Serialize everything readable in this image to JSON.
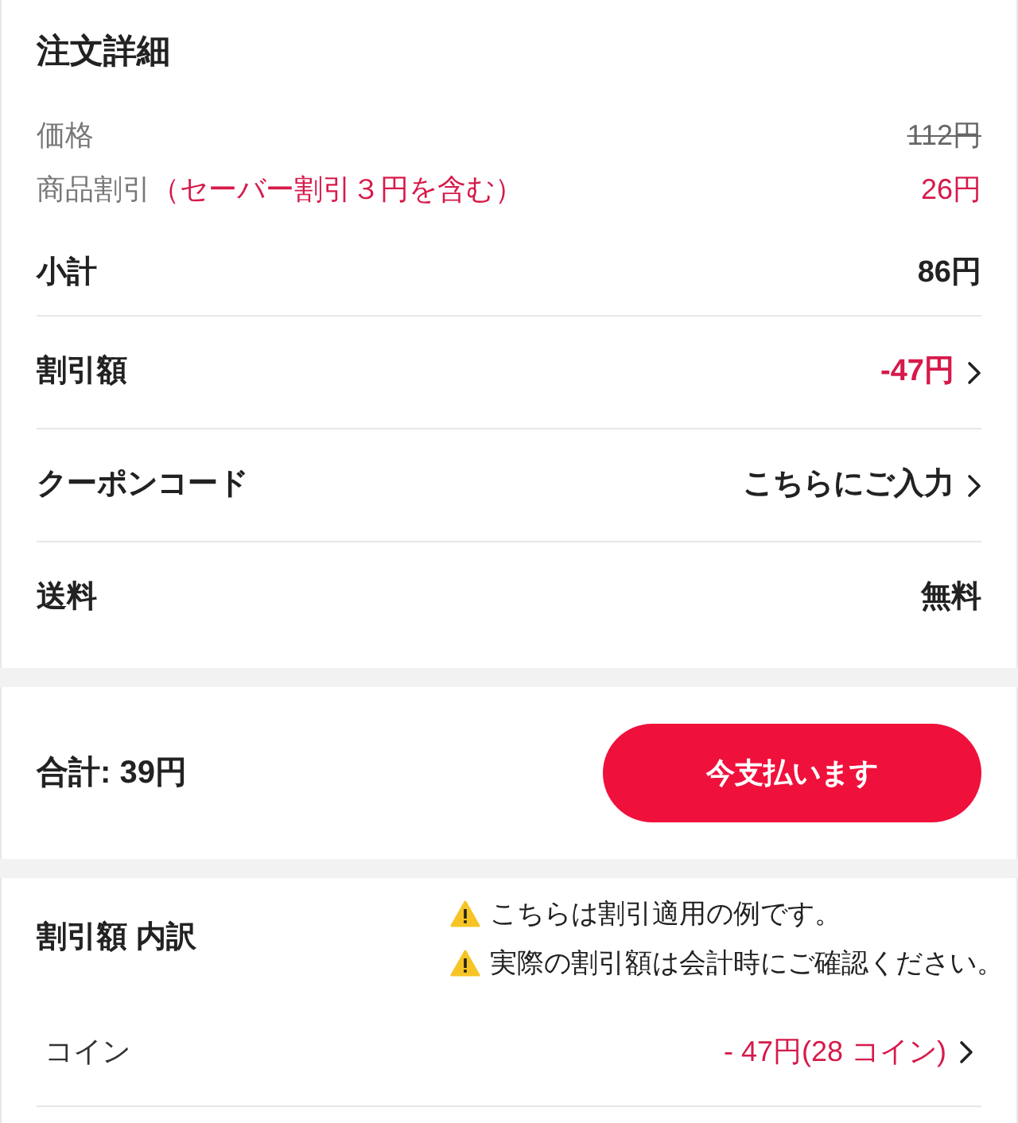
{
  "title": "注文詳細",
  "details": [
    {
      "kind": "struck",
      "label": "価格",
      "value": "112円"
    },
    {
      "kind": "discount",
      "label": "商品割引",
      "note": "（セーバー割引３円を含む）",
      "value": "26円"
    }
  ],
  "summary": [
    {
      "kind": "plain",
      "label": "小計",
      "value": "86円"
    },
    {
      "kind": "discount",
      "label": "割引額",
      "value": "-47円"
    },
    {
      "kind": "link",
      "label": "クーポンコード",
      "value": "こちらにご入力"
    },
    {
      "kind": "plain",
      "label": "送料",
      "value": "無料"
    }
  ],
  "total": {
    "label": "合計: 39円",
    "button": "今支払います"
  },
  "breakdown": {
    "title": "割引額 内訳",
    "warnings": [
      "こちらは割引適用の例です。",
      "実際の割引額は会計時にご確認ください。"
    ],
    "rows": [
      {
        "label": "コイン",
        "value": "- 47円(28 コイン)"
      }
    ]
  }
}
